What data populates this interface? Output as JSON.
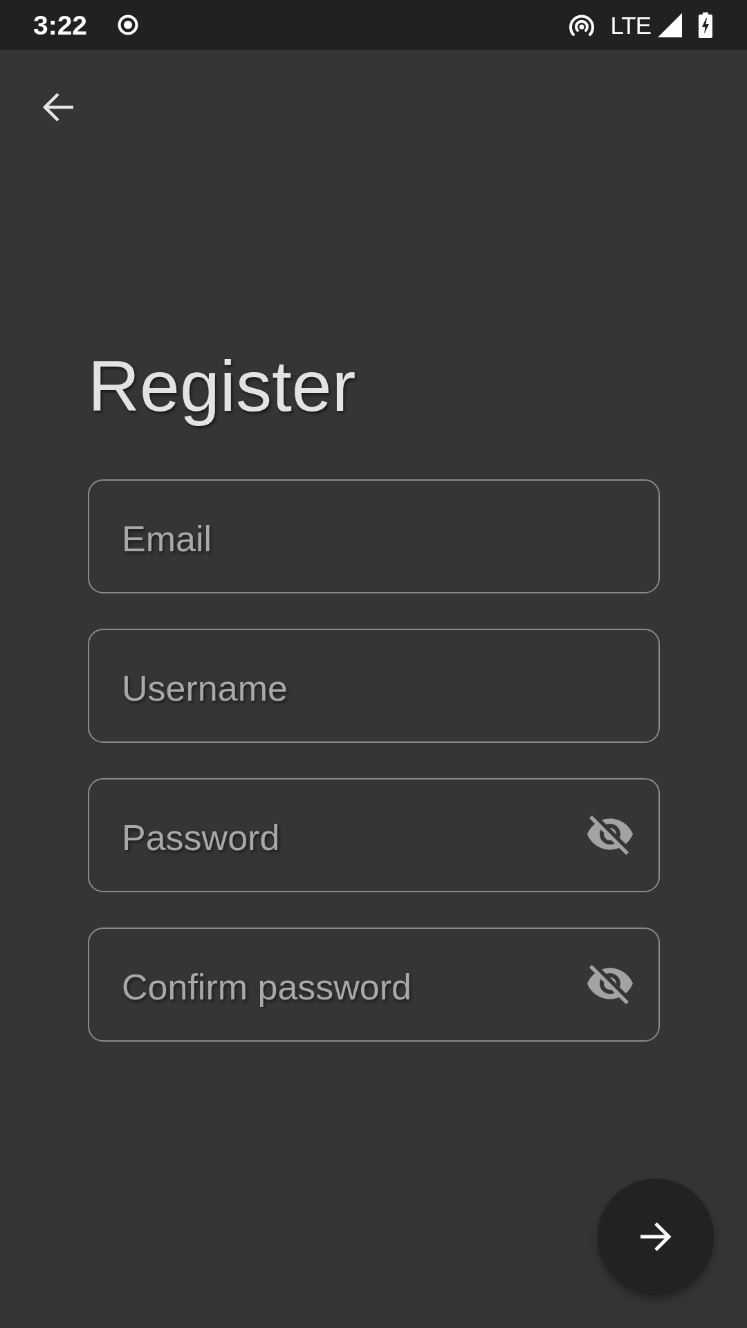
{
  "status_bar": {
    "time": "3:22",
    "network": "LTE"
  },
  "title": "Register",
  "fields": [
    {
      "kind": "text",
      "placeholder": "Email"
    },
    {
      "kind": "text",
      "placeholder": "Username"
    },
    {
      "kind": "password",
      "placeholder": "Password",
      "visible": false
    },
    {
      "kind": "password",
      "placeholder": "Confirm password",
      "visible": false
    }
  ]
}
